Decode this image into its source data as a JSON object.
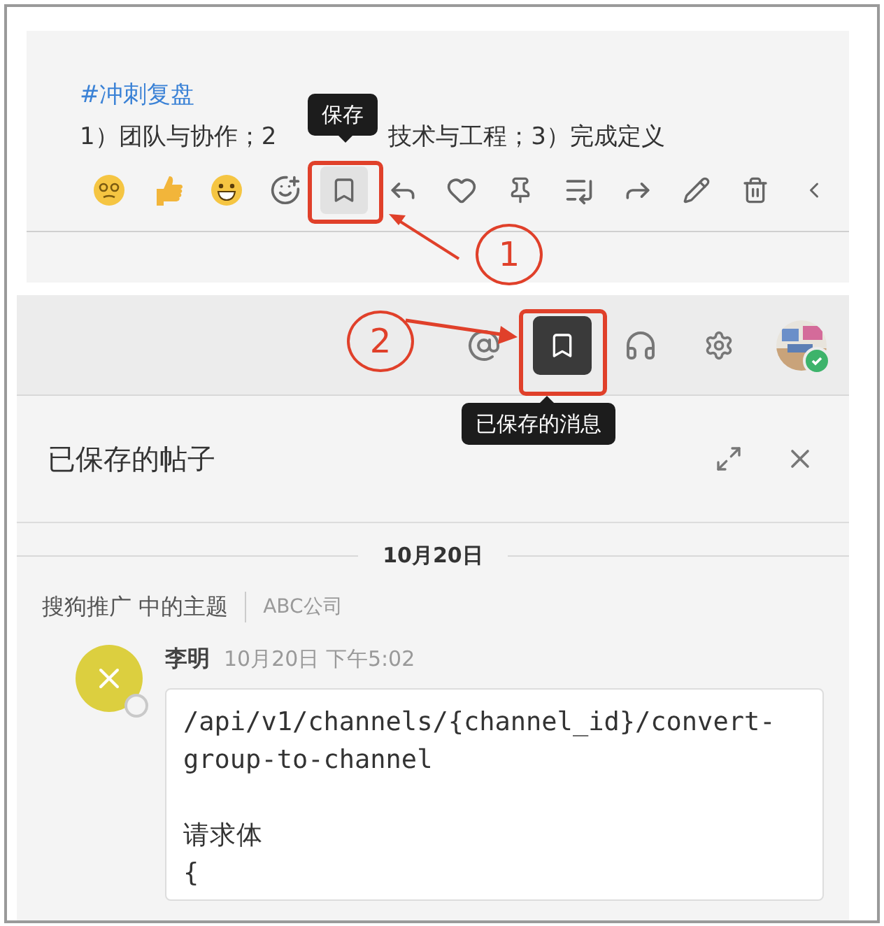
{
  "post_panel": {
    "hashtag": "#冲刺复盘",
    "text_before": "1）团队与协作；2",
    "text_after": "技术与工程；3）完成定义",
    "tooltip": "保存",
    "actions": [
      {
        "selected": false
      },
      {
        "selected": false
      },
      {
        "selected": false
      },
      {
        "selected": false
      },
      {
        "selected": true
      },
      {
        "selected": false
      },
      {
        "selected": false
      },
      {
        "selected": false
      },
      {
        "selected": false
      },
      {
        "selected": false
      },
      {
        "selected": false
      },
      {
        "selected": false
      },
      {
        "selected": false
      }
    ]
  },
  "header": {
    "buttons": [
      {
        "selected": false
      },
      {
        "selected": true
      },
      {
        "selected": false
      },
      {
        "selected": false
      }
    ],
    "avatar": {
      "online": true
    },
    "tooltip": "已保存的消息"
  },
  "saved_panel": {
    "title": "已保存的帖子",
    "date": "10月20日",
    "context": "搜狗推广 中的主题",
    "team": "ABC公司",
    "message": {
      "author": "李明",
      "time": "10月20日 下午5:02",
      "online": false,
      "code_blocks": [
        [
          "/api/v1/channels/{channel_id}/convert-",
          "group-to-channel"
        ],
        [
          "请求体",
          "{"
        ]
      ]
    }
  },
  "annotations": [
    {
      "label": "1"
    },
    {
      "label": "2"
    }
  ]
}
